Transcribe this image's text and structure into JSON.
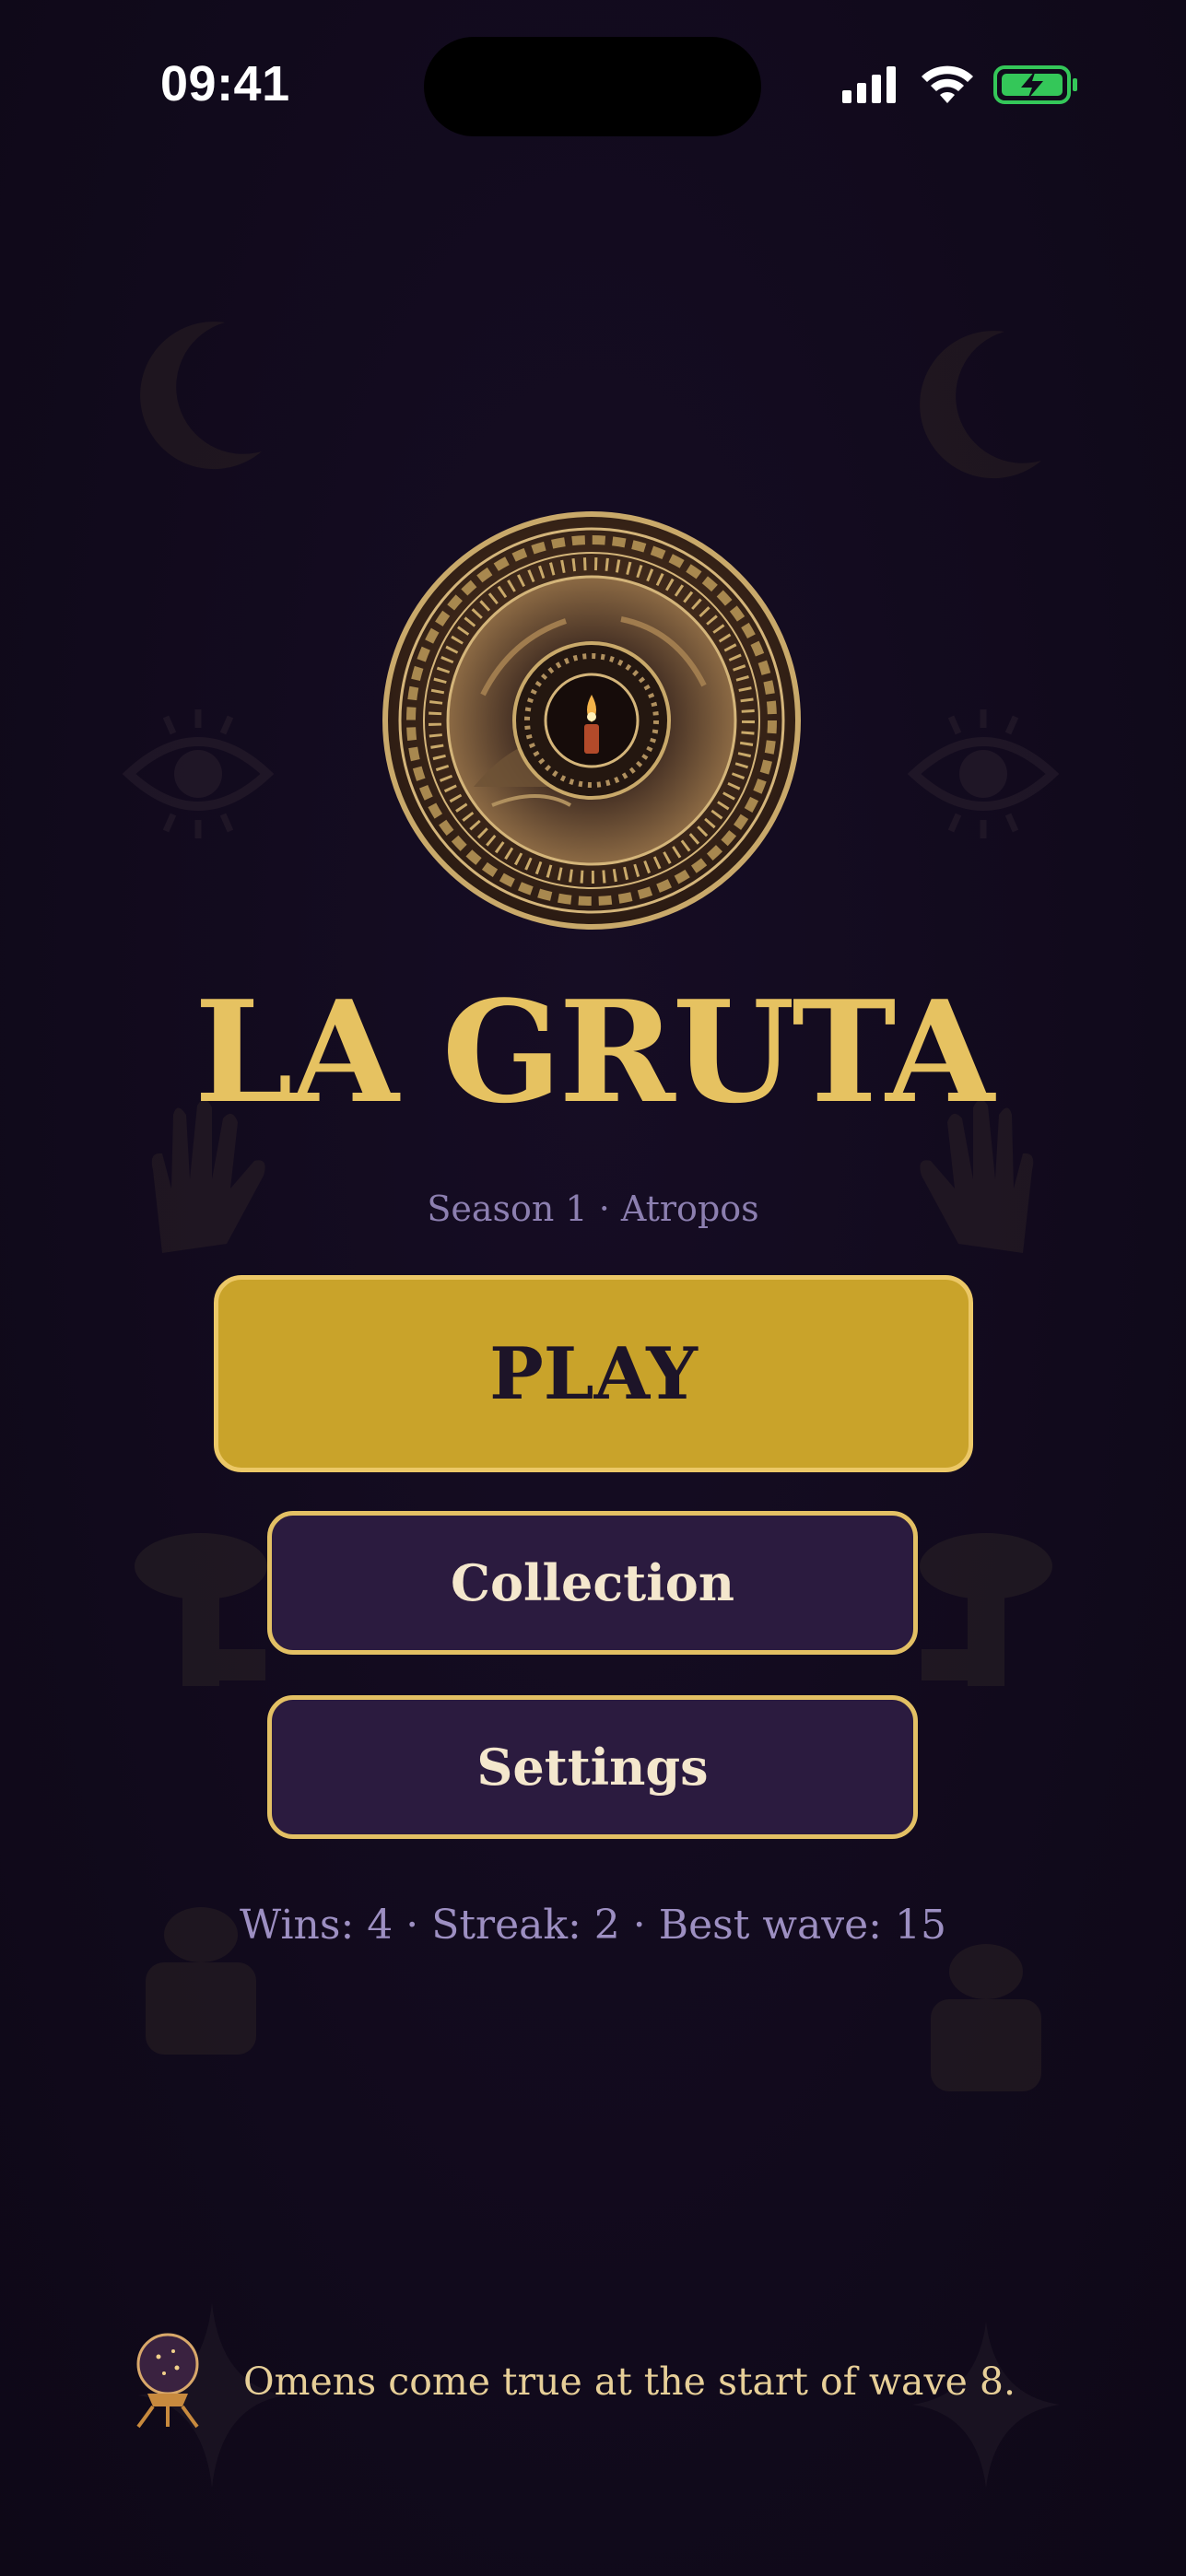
{
  "status_bar": {
    "time": "09:41",
    "icons": [
      "cellular-icon",
      "wifi-icon",
      "battery-charging-icon"
    ],
    "battery_color": "#34c759"
  },
  "app": {
    "title": "LA GRUTA",
    "subtitle": "Season 1 · Atropos",
    "emblem": "cave-rune-medallion"
  },
  "menu": {
    "play_label": "PLAY",
    "collection_label": "Collection",
    "settings_label": "Settings"
  },
  "stats_text": "Wins: 4 · Streak: 2 · Best wave: 15",
  "tip": {
    "icon": "crystal-ball-icon",
    "text": "Omens come true at the start of wave 8."
  },
  "colors": {
    "background": "#110a1c",
    "gold": "#e6c261",
    "play_button": "#c9a32a",
    "secondary_button": "#2b1b3f",
    "muted_text": "#8c7fb0"
  },
  "decorations": [
    "crescent-moon-icon",
    "eye-icon",
    "hand-icon",
    "key-icon",
    "potion-icon",
    "sparkle-icon"
  ]
}
